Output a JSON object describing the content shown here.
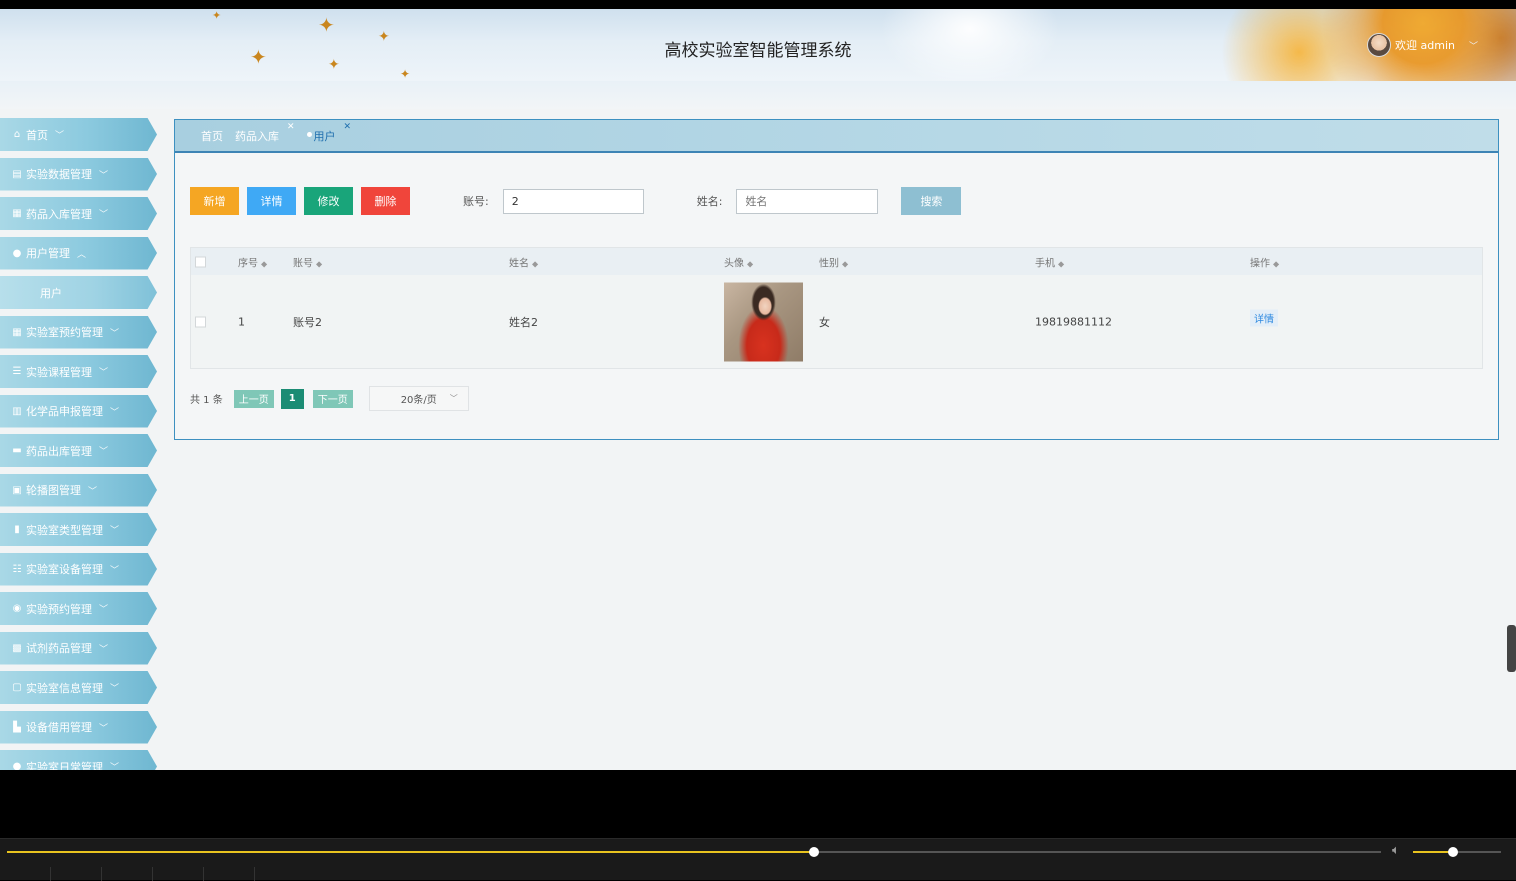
{
  "header": {
    "title": "高校实验室智能管理系统",
    "welcome": "欢迎 admin"
  },
  "sidebar": {
    "items": [
      {
        "label": "首页",
        "icon": "home-icon"
      },
      {
        "label": "实验数据管理",
        "icon": "document-icon"
      },
      {
        "label": "药品入库管理",
        "icon": "store-icon"
      },
      {
        "label": "用户管理",
        "icon": "user-icon",
        "expanded": true
      },
      {
        "label": "用户",
        "sub": true
      },
      {
        "label": "实验室预约管理",
        "icon": "grid-icon"
      },
      {
        "label": "实验课程管理",
        "icon": "list-icon"
      },
      {
        "label": "化学品申报管理",
        "icon": "table-icon"
      },
      {
        "label": "药品出库管理",
        "icon": "box-icon"
      },
      {
        "label": "轮播图管理",
        "icon": "briefcase-icon"
      },
      {
        "label": "实验室类型管理",
        "icon": "columns-icon"
      },
      {
        "label": "实验室设备管理",
        "icon": "server-icon"
      },
      {
        "label": "实验预约管理",
        "icon": "circle-icon"
      },
      {
        "label": "试剂药品管理",
        "icon": "gift-icon"
      },
      {
        "label": "实验室信息管理",
        "icon": "id-card-icon"
      },
      {
        "label": "设备借用管理",
        "icon": "crop-icon"
      },
      {
        "label": "实验室日常管理",
        "icon": "drop-icon"
      }
    ]
  },
  "tabs": [
    {
      "label": "首页",
      "closable": false
    },
    {
      "label": "药品入库",
      "closable": true
    },
    {
      "label": "用户",
      "closable": true,
      "active": true
    }
  ],
  "toolbar": {
    "add": "新增",
    "detail": "详情",
    "edit": "修改",
    "delete": "删除",
    "account_label": "账号:",
    "account_value": "2",
    "name_label": "姓名:",
    "name_placeholder": "姓名",
    "search": "搜索"
  },
  "table": {
    "columns": [
      "序号",
      "账号",
      "姓名",
      "头像",
      "性别",
      "手机",
      "操作"
    ],
    "rows": [
      {
        "index": "1",
        "account": "账号2",
        "name": "姓名2",
        "gender": "女",
        "phone": "19819881112",
        "action": "详情"
      }
    ]
  },
  "pager": {
    "total": "共 1 条",
    "prev": "上一页",
    "current": "1",
    "next": "下一页",
    "page_size": "20条/页"
  },
  "video": {
    "progress": 0.587,
    "volume": 0.45
  },
  "colors": {
    "add": "#f5a623",
    "detail": "#3fa9f5",
    "edit": "#19a57a",
    "delete": "#f0453b",
    "accent": "#3d84b5",
    "progress": "#e8c31f"
  }
}
